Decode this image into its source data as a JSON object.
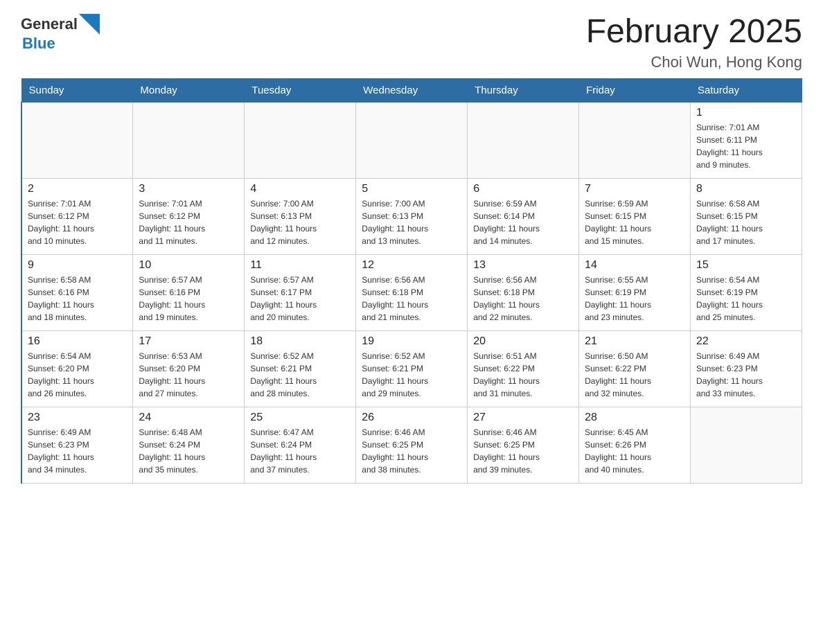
{
  "header": {
    "logo_general": "General",
    "logo_blue": "Blue",
    "month_title": "February 2025",
    "location": "Choi Wun, Hong Kong"
  },
  "weekdays": [
    "Sunday",
    "Monday",
    "Tuesday",
    "Wednesday",
    "Thursday",
    "Friday",
    "Saturday"
  ],
  "weeks": [
    [
      {
        "day": "",
        "info": ""
      },
      {
        "day": "",
        "info": ""
      },
      {
        "day": "",
        "info": ""
      },
      {
        "day": "",
        "info": ""
      },
      {
        "day": "",
        "info": ""
      },
      {
        "day": "",
        "info": ""
      },
      {
        "day": "1",
        "info": "Sunrise: 7:01 AM\nSunset: 6:11 PM\nDaylight: 11 hours\nand 9 minutes."
      }
    ],
    [
      {
        "day": "2",
        "info": "Sunrise: 7:01 AM\nSunset: 6:12 PM\nDaylight: 11 hours\nand 10 minutes."
      },
      {
        "day": "3",
        "info": "Sunrise: 7:01 AM\nSunset: 6:12 PM\nDaylight: 11 hours\nand 11 minutes."
      },
      {
        "day": "4",
        "info": "Sunrise: 7:00 AM\nSunset: 6:13 PM\nDaylight: 11 hours\nand 12 minutes."
      },
      {
        "day": "5",
        "info": "Sunrise: 7:00 AM\nSunset: 6:13 PM\nDaylight: 11 hours\nand 13 minutes."
      },
      {
        "day": "6",
        "info": "Sunrise: 6:59 AM\nSunset: 6:14 PM\nDaylight: 11 hours\nand 14 minutes."
      },
      {
        "day": "7",
        "info": "Sunrise: 6:59 AM\nSunset: 6:15 PM\nDaylight: 11 hours\nand 15 minutes."
      },
      {
        "day": "8",
        "info": "Sunrise: 6:58 AM\nSunset: 6:15 PM\nDaylight: 11 hours\nand 17 minutes."
      }
    ],
    [
      {
        "day": "9",
        "info": "Sunrise: 6:58 AM\nSunset: 6:16 PM\nDaylight: 11 hours\nand 18 minutes."
      },
      {
        "day": "10",
        "info": "Sunrise: 6:57 AM\nSunset: 6:16 PM\nDaylight: 11 hours\nand 19 minutes."
      },
      {
        "day": "11",
        "info": "Sunrise: 6:57 AM\nSunset: 6:17 PM\nDaylight: 11 hours\nand 20 minutes."
      },
      {
        "day": "12",
        "info": "Sunrise: 6:56 AM\nSunset: 6:18 PM\nDaylight: 11 hours\nand 21 minutes."
      },
      {
        "day": "13",
        "info": "Sunrise: 6:56 AM\nSunset: 6:18 PM\nDaylight: 11 hours\nand 22 minutes."
      },
      {
        "day": "14",
        "info": "Sunrise: 6:55 AM\nSunset: 6:19 PM\nDaylight: 11 hours\nand 23 minutes."
      },
      {
        "day": "15",
        "info": "Sunrise: 6:54 AM\nSunset: 6:19 PM\nDaylight: 11 hours\nand 25 minutes."
      }
    ],
    [
      {
        "day": "16",
        "info": "Sunrise: 6:54 AM\nSunset: 6:20 PM\nDaylight: 11 hours\nand 26 minutes."
      },
      {
        "day": "17",
        "info": "Sunrise: 6:53 AM\nSunset: 6:20 PM\nDaylight: 11 hours\nand 27 minutes."
      },
      {
        "day": "18",
        "info": "Sunrise: 6:52 AM\nSunset: 6:21 PM\nDaylight: 11 hours\nand 28 minutes."
      },
      {
        "day": "19",
        "info": "Sunrise: 6:52 AM\nSunset: 6:21 PM\nDaylight: 11 hours\nand 29 minutes."
      },
      {
        "day": "20",
        "info": "Sunrise: 6:51 AM\nSunset: 6:22 PM\nDaylight: 11 hours\nand 31 minutes."
      },
      {
        "day": "21",
        "info": "Sunrise: 6:50 AM\nSunset: 6:22 PM\nDaylight: 11 hours\nand 32 minutes."
      },
      {
        "day": "22",
        "info": "Sunrise: 6:49 AM\nSunset: 6:23 PM\nDaylight: 11 hours\nand 33 minutes."
      }
    ],
    [
      {
        "day": "23",
        "info": "Sunrise: 6:49 AM\nSunset: 6:23 PM\nDaylight: 11 hours\nand 34 minutes."
      },
      {
        "day": "24",
        "info": "Sunrise: 6:48 AM\nSunset: 6:24 PM\nDaylight: 11 hours\nand 35 minutes."
      },
      {
        "day": "25",
        "info": "Sunrise: 6:47 AM\nSunset: 6:24 PM\nDaylight: 11 hours\nand 37 minutes."
      },
      {
        "day": "26",
        "info": "Sunrise: 6:46 AM\nSunset: 6:25 PM\nDaylight: 11 hours\nand 38 minutes."
      },
      {
        "day": "27",
        "info": "Sunrise: 6:46 AM\nSunset: 6:25 PM\nDaylight: 11 hours\nand 39 minutes."
      },
      {
        "day": "28",
        "info": "Sunrise: 6:45 AM\nSunset: 6:26 PM\nDaylight: 11 hours\nand 40 minutes."
      },
      {
        "day": "",
        "info": ""
      }
    ]
  ]
}
